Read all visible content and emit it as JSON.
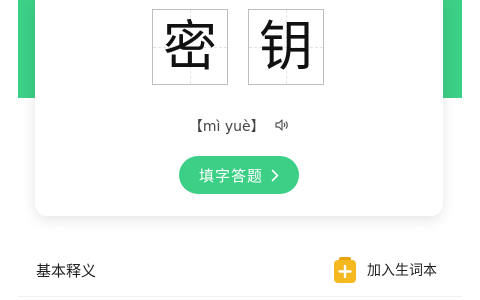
{
  "word": {
    "characters": [
      "密",
      "钥"
    ],
    "pinyin": "【mì yuè】"
  },
  "icons": {
    "speaker": "speaker-icon",
    "chevron": "chevron-right-icon",
    "add": "notebook-add-icon"
  },
  "quiz": {
    "label": "填字答题"
  },
  "definition": {
    "section_title": "基本释义",
    "add_label": "加入生词本"
  },
  "colors": {
    "accent": "#3ccf86",
    "add_icon": "#f6b81f"
  }
}
